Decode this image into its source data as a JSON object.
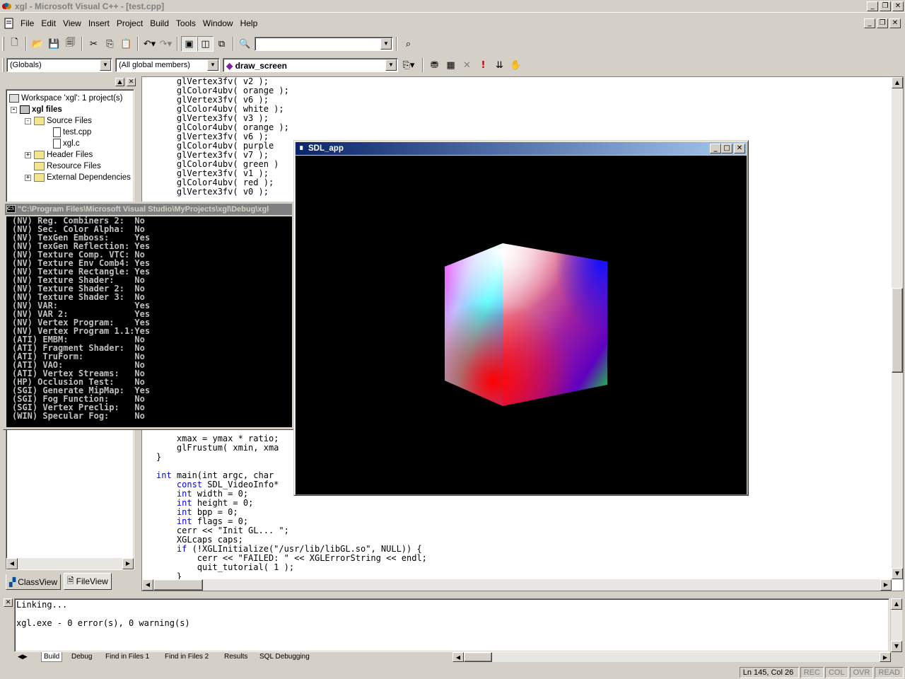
{
  "window": {
    "title": "xgl - Microsoft Visual C++ - [test.cpp]"
  },
  "menu": [
    "File",
    "Edit",
    "View",
    "Insert",
    "Project",
    "Build",
    "Tools",
    "Window",
    "Help"
  ],
  "toolbar": {
    "find_combo_value": ""
  },
  "wizardbar": {
    "class_combo": "(Globals)",
    "filter_combo": "(All global members)",
    "member_combo": "draw_screen"
  },
  "workspace": {
    "root": "Workspace 'xgl': 1 project(s)",
    "project": "xgl files",
    "source_folder": "Source Files",
    "files": [
      "test.cpp",
      "xgl.c"
    ],
    "header_folder": "Header Files",
    "resource_folder": "Resource Files",
    "deps_folder": "External Dependencies",
    "tabs": [
      "ClassView",
      "FileView"
    ]
  },
  "editor": {
    "lines_top": [
      "    glVertex3fv( v2 );",
      "    glColor4ubv( orange );",
      "    glVertex3fv( v6 );",
      "    glColor4ubv( white );",
      "    glVertex3fv( v3 );",
      "    glColor4ubv( orange );",
      "    glVertex3fv( v6 );",
      "    glColor4ubv( purple",
      "    glVertex3fv( v7 );",
      "    glColor4ubv( green )",
      "    glVertex3fv( v1 );",
      "    glColor4ubv( red );",
      "    glVertex3fv( v0 );"
    ],
    "lines_bottom": [
      "    xmax = ymax * ratio;",
      "    glFrustum( xmin, xma",
      "}",
      "",
      "int main(int argc, char",
      "    const SDL_VideoInfo*",
      "    int width = 0;",
      "    int height = 0;",
      "    int bpp = 0;",
      "    int flags = 0;",
      "    cerr << \"Init GL... \";",
      "    XGLcaps caps;",
      "    if (!XGLInitialize(\"/usr/lib/libGL.so\", NULL)) {",
      "        cerr << \"FAILED: \" << XGLErrorString << endl;",
      "        quit_tutorial( 1 );",
      "    }"
    ]
  },
  "console": {
    "title": "\"C:\\Program Files\\Microsoft Visual Studio\\MyProjects\\xgl\\Debug\\xgl",
    "lines": [
      "(NV) Reg. Combiners 2:  No",
      "(NV) Sec. Color Alpha:  No",
      "(NV) TexGen Emboss:     Yes",
      "(NV) TexGen Reflection: Yes",
      "(NV) Texture Comp. VTC: No",
      "(NV) Texture Env Comb4: Yes",
      "(NV) Texture Rectangle: Yes",
      "(NV) Texture Shader:    No",
      "(NV) Texture Shader 2:  No",
      "(NV) Texture Shader 3:  No",
      "(NV) VAR:               Yes",
      "(NV) VAR 2:             Yes",
      "(NV) Vertex Program:    Yes",
      "(NV) Vertex Program 1.1:Yes",
      "(ATI) EMBM:             No",
      "(ATI) Fragment Shader:  No",
      "(ATI) TruForm:          No",
      "(ATI) VAO:              No",
      "(ATI) Vertex Streams:   No",
      "(HP) Occlusion Test:    No",
      "(SGI) Generate MipMap:  Yes",
      "(SGI) Fog Function:     No",
      "(SGI) Vertex Preclip:   No",
      "(WIN) Specular Fog:     No"
    ]
  },
  "sdl": {
    "title": "SDL_app"
  },
  "output": {
    "lines": [
      "Linking...",
      "",
      "xgl.exe - 0 error(s), 0 warning(s)"
    ],
    "tabs": [
      "Build",
      "Debug",
      "Find in Files 1",
      "Find in Files 2",
      "Results",
      "SQL Debugging"
    ]
  },
  "status": {
    "position": "Ln 145, Col 26",
    "indicators": [
      "REC",
      "COL",
      "OVR",
      "READ"
    ]
  }
}
